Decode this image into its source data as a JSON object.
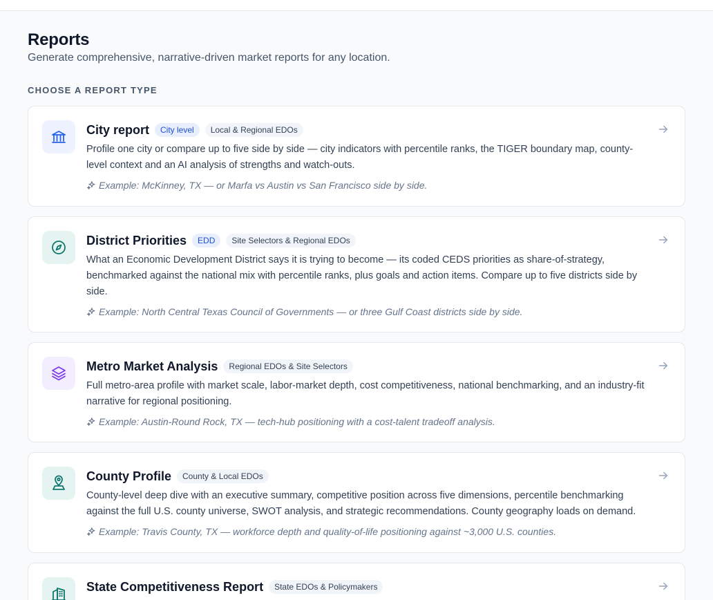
{
  "header": {
    "title": "Reports",
    "subtitle": "Generate comprehensive, narrative-driven market reports for any location.",
    "section_label": "CHOOSE A REPORT TYPE"
  },
  "reports": [
    {
      "title": "City report",
      "badges": [
        "City level",
        "Local & Regional EDOs"
      ],
      "description": "Profile one city or compare up to five side by side — city indicators with percentile ranks, the TIGER boundary map, county-level context and an AI analysis of strengths and watch-outs.",
      "example": "Example: McKinney, TX — or Marfa vs Austin vs San Francisco side by side.",
      "icon": "bank-icon",
      "icon_color": "#2563eb",
      "icon_bg": "#eef2ff"
    },
    {
      "title": "District Priorities",
      "badges": [
        "EDD",
        "Site Selectors & Regional EDOs"
      ],
      "description": "What an Economic Development District says it is trying to become — its coded CEDS priorities as share-of-strategy, benchmarked against the national mix with percentile ranks, plus goals and action items. Compare up to five districts side by side.",
      "example": "Example: North Central Texas Council of Governments — or three Gulf Coast districts side by side.",
      "icon": "compass-icon",
      "icon_color": "#0f766e",
      "icon_bg": "#e6f4f1"
    },
    {
      "title": "Metro Market Analysis",
      "badges": [
        "Regional EDOs & Site Selectors"
      ],
      "description": "Full metro-area profile with market scale, labor-market depth, cost competitiveness, national benchmarking, and an industry-fit narrative for regional positioning.",
      "example": "Example: Austin-Round Rock, TX — tech-hub positioning with a cost-talent tradeoff analysis.",
      "icon": "layers-icon",
      "icon_color": "#7c3aed",
      "icon_bg": "#f3eefe"
    },
    {
      "title": "County Profile",
      "badges": [
        "County & Local EDOs"
      ],
      "description": "County-level deep dive with an executive summary, competitive position across five dimensions, percentile benchmarking against the full U.S. county universe, SWOT analysis, and strategic recommendations. County geography loads on demand.",
      "example": "Example: Travis County, TX — workforce depth and quality-of-life positioning against ~3,000 U.S. counties.",
      "icon": "map-pin-icon",
      "icon_color": "#0f766e",
      "icon_bg": "#e6f4f1"
    },
    {
      "title": "State Competitiveness Report",
      "badges": [
        "State EDOs & Policymakers"
      ],
      "description": "",
      "example": "",
      "icon": "building-icon",
      "icon_color": "#0f766e",
      "icon_bg": "#e6f4f1"
    }
  ]
}
